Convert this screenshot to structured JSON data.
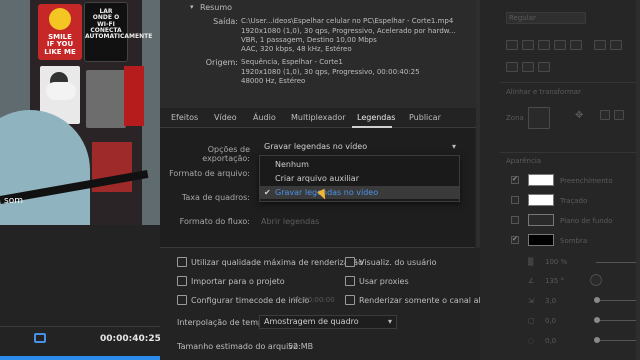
{
  "webcam": {
    "sign_red_text": "SMILE\nIF YOU\nLIKE ME",
    "sign_wifi_text": "LAR\nONDE O\nWI-FI\nCONECTA\nAUTOMATICAMENTE",
    "caption": "som"
  },
  "left_panel": {
    "timecode": "00:00:40:25"
  },
  "summary": {
    "heading": "Resumo",
    "output_label": "Saída:",
    "output_lines": [
      "C:\\User...ideos\\Espelhar celular no PC\\Espelhar - Corte1.mp4",
      "1920x1080 (1,0), 30 qps, Progressivo, Acelerado por hardw...",
      "VBR, 1 passagem, Destino 10,00 Mbps",
      "AAC, 320 kbps, 48 kHz, Estéreo"
    ],
    "source_label": "Origem:",
    "source_lines": [
      "Sequência, Espelhar - Corte1",
      "1920x1080 (1,0), 30 qps, Progressivo, 00:00:40:25",
      "48000 Hz, Estéreo"
    ]
  },
  "tabs": [
    {
      "label": "Efeitos"
    },
    {
      "label": "Vídeo"
    },
    {
      "label": "Áudio"
    },
    {
      "label": "Multiplexador"
    },
    {
      "label": "Legendas"
    },
    {
      "label": "Publicar"
    }
  ],
  "captions": {
    "export_options_label": "Opções de exportação:",
    "export_options_value": "Gravar legendas no vídeo",
    "file_format_label": "Formato de arquivo:",
    "frame_rate_label": "Taxa de quadros:",
    "stream_format_label": "Formato do fluxo:",
    "stream_format_value": "Abrir legendas",
    "dropdown_options": [
      "Nenhum",
      "Criar arquivo auxiliar",
      "Gravar legendas no vídeo"
    ]
  },
  "options": {
    "max_render_quality": "Utilizar qualidade máxima de renderização",
    "preview": "Visualiz. do usuário",
    "import_project": "Importar para o projeto",
    "use_proxies": "Usar proxies",
    "set_timecode": "Configurar timecode de início",
    "timecode_value": "00:00:00:00",
    "render_alpha": "Renderizar somente o canal alfa",
    "interp_label": "Interpolação de tempo:",
    "interp_value": "Amostragem de quadro",
    "size_label": "Tamanho estimado do arquivo:",
    "size_value": "52 MB"
  },
  "right_panel": {
    "font_style": "Regular",
    "align_transform": "Alinhar e transformar",
    "zona": "Zona",
    "aparencia": "Aparência",
    "fill": "Preenchimento",
    "stroke": "Traçado",
    "background": "Plano de fundo",
    "shadow": "Sombra",
    "val1": "100 %",
    "val2": "135 °",
    "val3": "3,0",
    "val4": "0,0",
    "val5": "0,0"
  },
  "colors": {
    "accent_blue": "#4c93ea",
    "panel_dark": "#232323"
  }
}
